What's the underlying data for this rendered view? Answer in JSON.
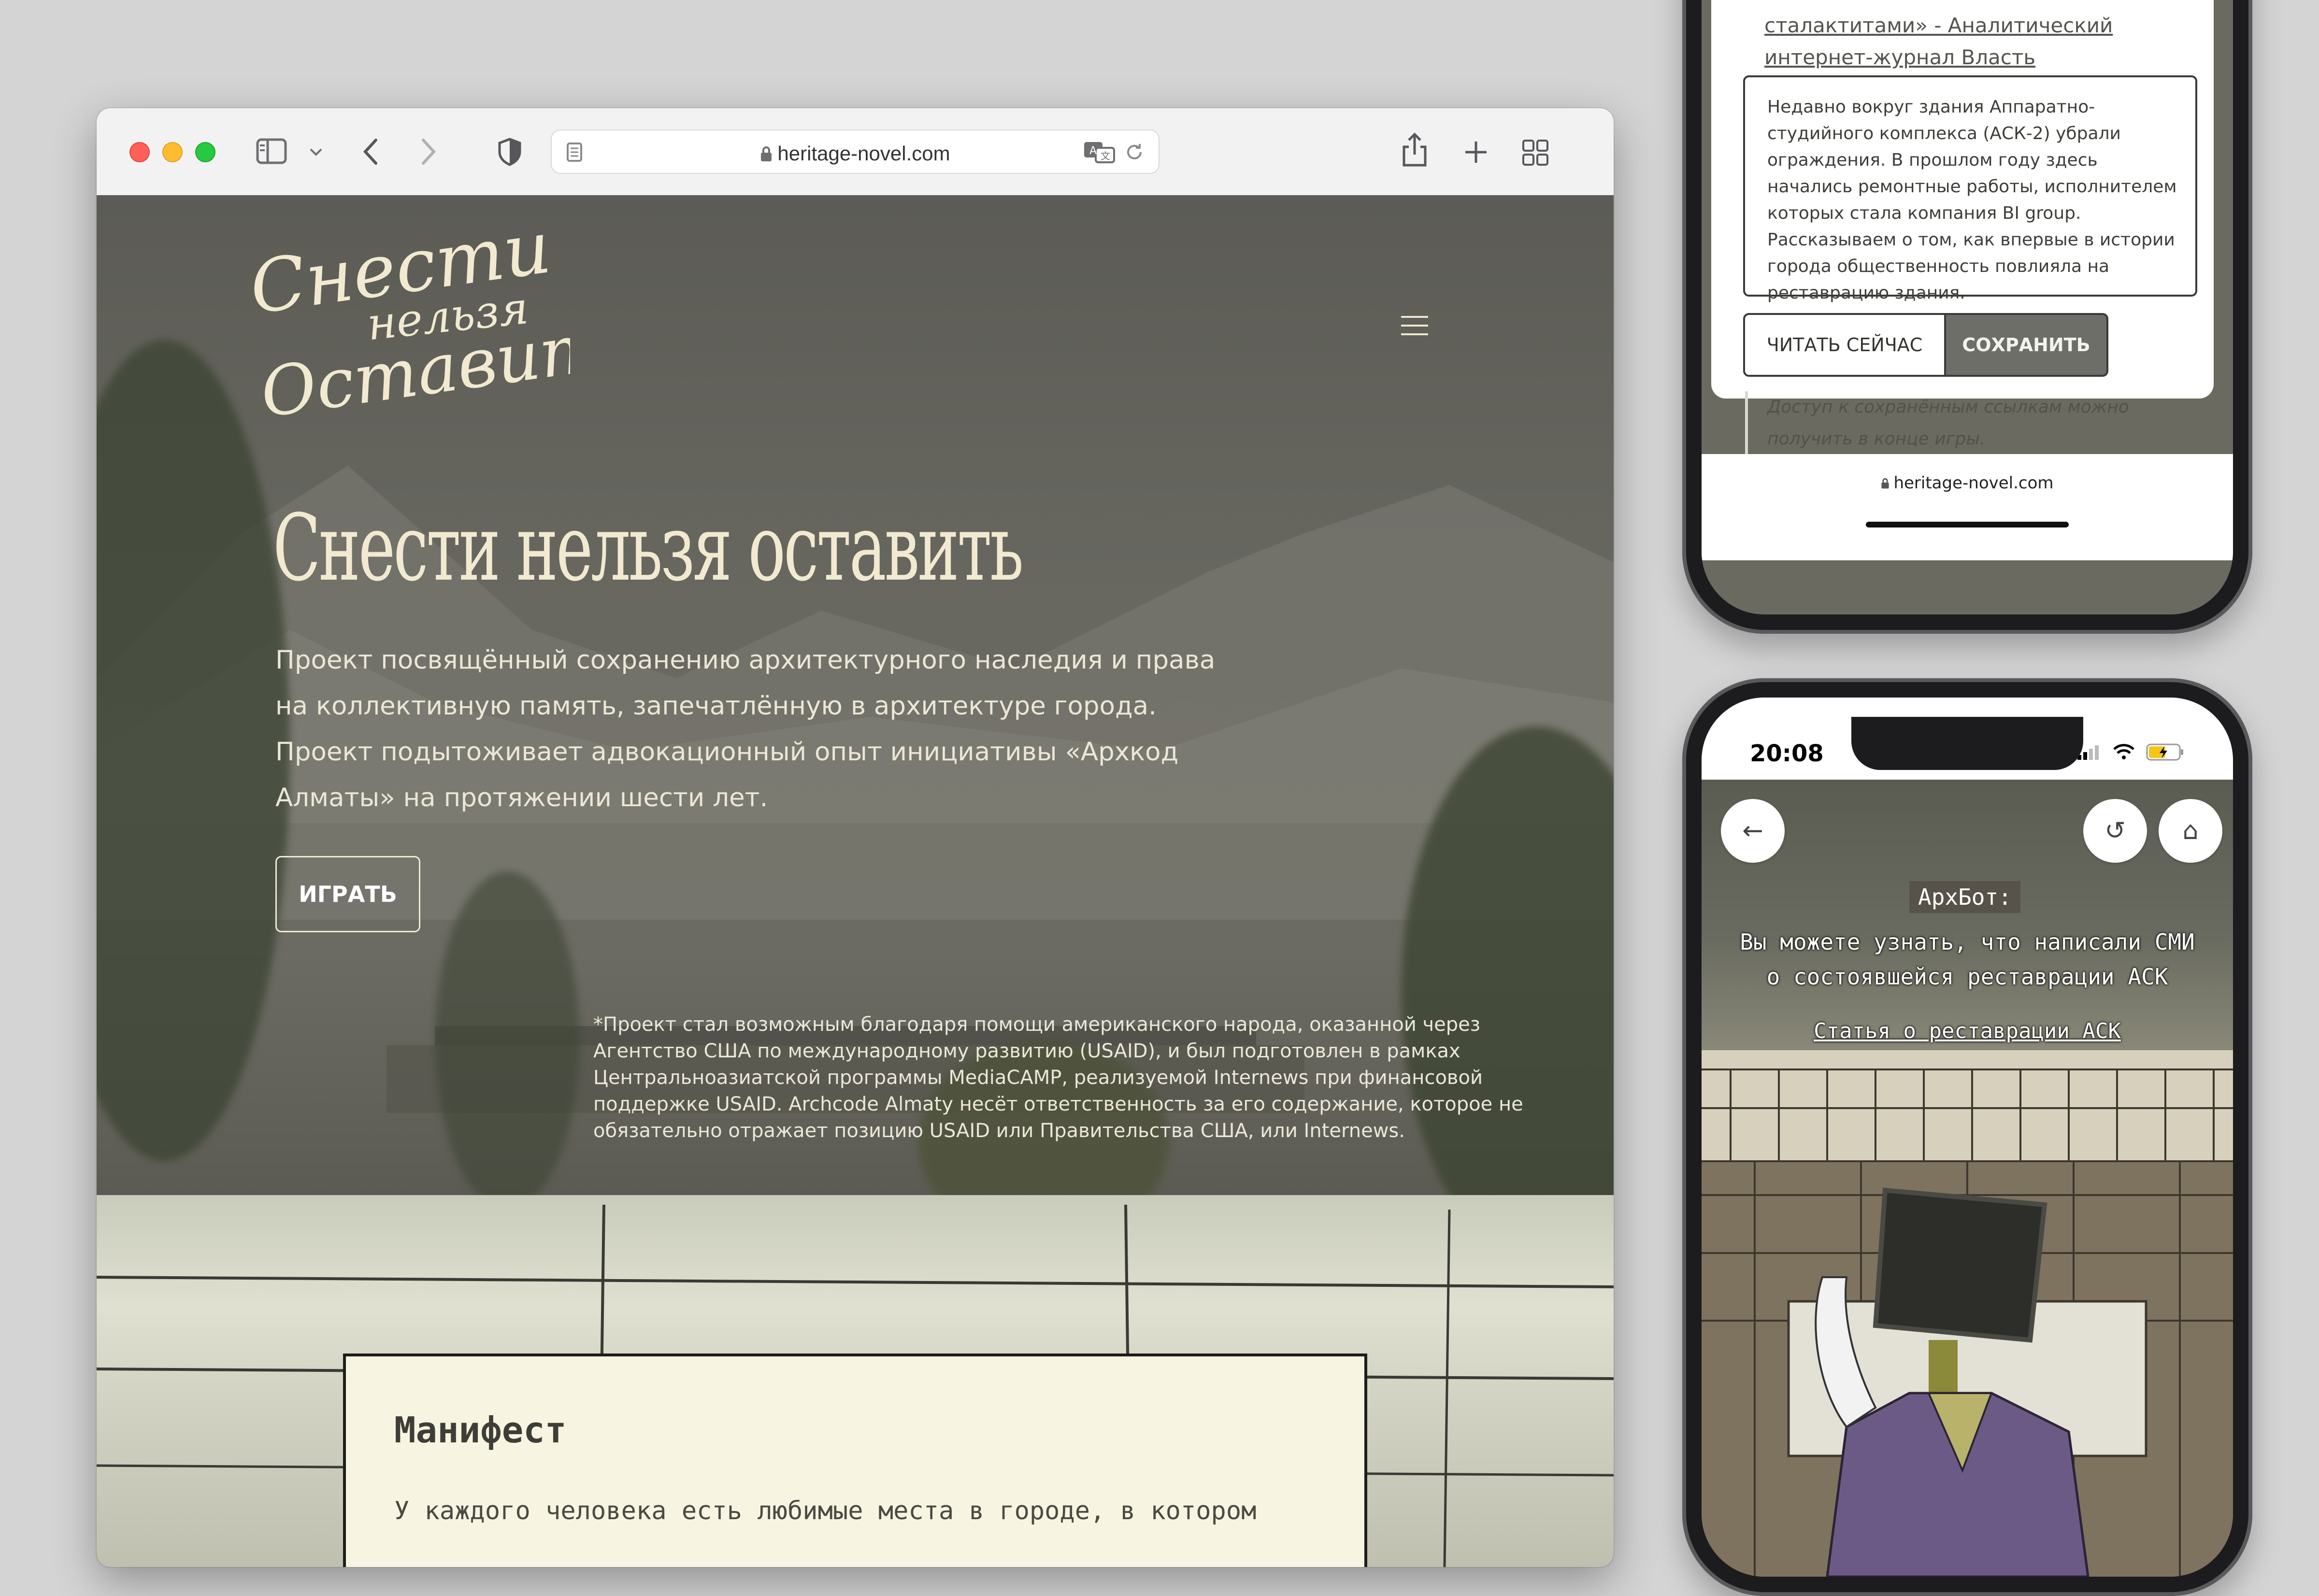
{
  "browser": {
    "url": "heritage-novel.com",
    "icons": {
      "sidebar": "sidebar-icon",
      "back": "chevron-left-icon",
      "forward": "chevron-right-icon",
      "shield": "shield-icon",
      "reader": "reader-icon",
      "lock": "lock-icon",
      "translate": "translate-icon",
      "reload": "reload-icon",
      "share": "share-icon",
      "new_tab": "plus-icon",
      "tabs": "tab-overview-icon"
    }
  },
  "site": {
    "logo_text": [
      "Снести",
      "нельзя",
      "Оставить"
    ],
    "hero_title": "Снести нельзя оставить",
    "hero_description": "Проект посвящённый сохранению архитектурного наследия и права на коллективную память, запечатлённую в архитектуре города. Проект подытоживает адвокационный опыт инициативы «Архкод Алматы» на протяжении шести лет.",
    "play_button": "ИГРАТЬ",
    "disclaimer": "*Проект стал возможным благодаря помощи американского народа, оказанной через Агентство США по международному развитию (USAID), и был подготовлен в рамках Центральноазиатской программы MediaCAMP, реализуемой Internews при финансовой поддержке USAID. Archcode Almaty несёт ответственность за его содержание, которое не обязательно отражает позицию USAID или Правительства США, или Internews.",
    "manifest_title": "Манифест",
    "manifest_text": "У каждого человека есть любимые места в городе, в котором"
  },
  "phone_top": {
    "link_text": "сталактитами» - Аналитический интернет-журнал Власть",
    "body": "Недавно вокруг здания Аппаратно-студийного комплекса (АСК-2) убрали ограждения. В прошлом году здесь начались ремонтные работы, исполнителем которых стала компания BI group. Рассказываем о том, как впервые в истории города общественность повлияла на реставрацию здания.",
    "read_now": "ЧИТАТЬ СЕЙЧАС",
    "save": "СОХРАНИТЬ",
    "note": "Доступ к сохранённым ссылкам можно получить в конце игры.",
    "url": "heritage-novel.com"
  },
  "phone_bottom": {
    "time": "20:08",
    "speaker": "АрхБот:",
    "dialog": "Вы можете узнать, что написали СМИ о состоявшейся реставрации АСК",
    "article_link": "Статья о реставрации АСК",
    "icons": {
      "back": "arrow-left-icon",
      "restart": "restart-icon",
      "home": "home-icon"
    }
  },
  "colors": {
    "cream": "#f1ead0",
    "button_gray": "#6e6e68",
    "traffic_red": "#fe5f57",
    "traffic_yellow": "#febc2e",
    "traffic_green": "#28c840"
  }
}
